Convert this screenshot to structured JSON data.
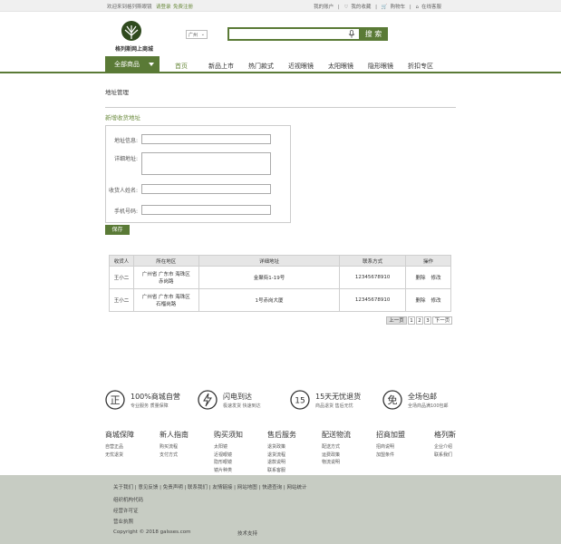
{
  "topbar": {
    "welcome": "欢迎来到格列斯眼镜",
    "login": "请登录",
    "register": "免费注册",
    "my_account": "我的账户",
    "favorites": "我的收藏",
    "cart": "购物车",
    "online_service": "在线客服"
  },
  "logo": {
    "text": "格列斯网上商城"
  },
  "city": {
    "value": "广州"
  },
  "search": {
    "placeholder": "",
    "button": "搜 索"
  },
  "nav": {
    "all_label": "全部商品",
    "items": [
      "首页",
      "新品上市",
      "热门款式",
      "近视眼镜",
      "太阳眼镜",
      "隐形眼镜",
      "折扣专区"
    ]
  },
  "page": {
    "title": "地址管理",
    "new_address": "新增收货地址"
  },
  "form": {
    "address_info_label": "地址信息:",
    "detail_label": "详细地址:",
    "name_label": "收货人姓名:",
    "phone_label": "手机号码:",
    "save": "保存"
  },
  "table": {
    "headers": [
      "收货人",
      "所在地区",
      "详细地址",
      "联系方式",
      "操作"
    ],
    "rows": [
      {
        "name": "王小二",
        "region1": "广州省 广东市 海珠区",
        "region2": "赤岗路",
        "detail": "金聚街1-19号",
        "phone": "12345678910",
        "delete": "删除",
        "edit": "修改"
      },
      {
        "name": "王小二",
        "region1": "广州省 广东市 海珠区",
        "region2": "石榴岗路",
        "detail": "1号赤岗大厦",
        "phone": "12345678910",
        "delete": "删除",
        "edit": "修改"
      }
    ]
  },
  "pager": {
    "prev": "上一页",
    "pages": [
      "1",
      "2",
      "3"
    ],
    "next": "下一页"
  },
  "guarantees": [
    {
      "icon": "genuine-icon",
      "glyph": "正",
      "title": "100%商城自营",
      "sub": "专业服务 质量保障"
    },
    {
      "icon": "lightning-icon",
      "glyph": "⚡",
      "title": "闪电到达",
      "sub": "极速发货 快速到达"
    },
    {
      "icon": "fifteen-day-icon",
      "glyph": "15",
      "title": "15天无忧退货",
      "sub": "商品退货 售后无忧"
    },
    {
      "icon": "free-shipping-icon",
      "glyph": "免",
      "title": "全场包邮",
      "sub": "全场商品满100包邮"
    }
  ],
  "footer_columns": [
    {
      "heading": "商城保障",
      "links": [
        "自营正品",
        "无忧退货"
      ]
    },
    {
      "heading": "新人指南",
      "links": [
        "购买流程",
        "支付方式"
      ]
    },
    {
      "heading": "购买须知",
      "links": [
        "太阳镜",
        "近视眼镜",
        "隐形眼镜",
        "镜片种类"
      ]
    },
    {
      "heading": "售后服务",
      "links": [
        "退货政策",
        "退货流程",
        "退款说明",
        "联系客服"
      ]
    },
    {
      "heading": "配送物流",
      "links": [
        "配送方式",
        "运费政策",
        "物流说明"
      ]
    },
    {
      "heading": "招商加盟",
      "links": [
        "招商说明",
        "加盟条件"
      ]
    },
    {
      "heading": "格列斯",
      "links": [
        "企业介绍",
        "联系我们"
      ]
    }
  ],
  "bottom": {
    "links": "关于我们 | 意见反馈 | 免责声明 | 联系我们 | 友情链接 | 网站地图 | 快递查询 | 网站统计",
    "org_code": "组织机构代码",
    "license": "经营许可证",
    "business_license": "营业执照",
    "copyright": "Copyright © 2018 galsses.com",
    "tech": "技术支持"
  },
  "colors": {
    "brand": "#5a7a36",
    "accent_text": "#6a8a3c",
    "footer_bg": "#c7ccc3"
  }
}
